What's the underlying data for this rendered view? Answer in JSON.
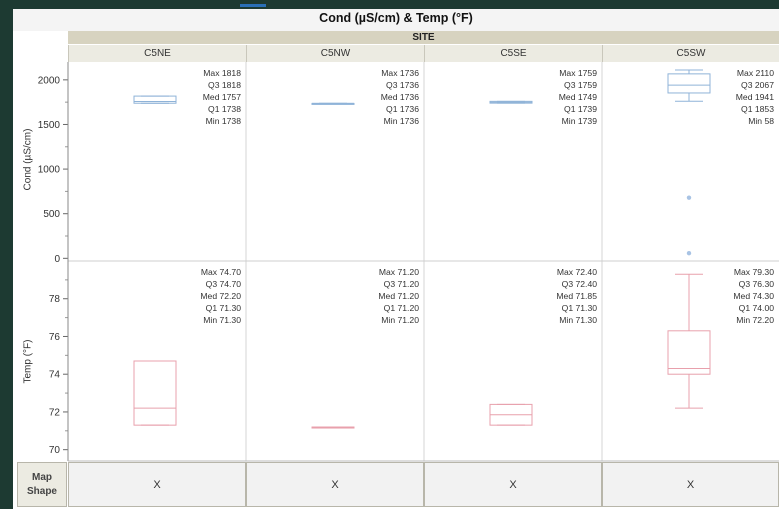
{
  "window_title": "Cond (µS/cm) & Temp (°F)",
  "group_label": "SITE",
  "map_shape_label": "Map\nShape",
  "map_shape_values": [
    "X",
    "X",
    "X",
    "X"
  ],
  "chart_data": {
    "type": "box",
    "title": "Cond (µS/cm) & Temp (°F)",
    "group_by": "SITE",
    "categories": [
      "C5NE",
      "C5NW",
      "C5SE",
      "C5SW"
    ],
    "panels": [
      {
        "ylabel": "Cond (µS/cm)",
        "ylim": [
          -30,
          2200
        ],
        "yticks": [
          0,
          500,
          1000,
          1500,
          2000
        ],
        "color": "#8fb3d8",
        "series": [
          {
            "site": "C5NE",
            "max": 1818,
            "q3": 1818,
            "med": 1757,
            "q1": 1738,
            "min": 1738,
            "outliers": [],
            "labels": [
              "Max 1818",
              "Q3 1818",
              "Med 1757",
              "Q1 1738",
              "Min 1738"
            ]
          },
          {
            "site": "C5NW",
            "max": 1736,
            "q3": 1736,
            "med": 1736,
            "q1": 1736,
            "min": 1736,
            "outliers": [],
            "labels": [
              "Max 1736",
              "Q3 1736",
              "Med 1736",
              "Q1 1736",
              "Min 1736"
            ]
          },
          {
            "site": "C5SE",
            "max": 1759,
            "q3": 1759,
            "med": 1749,
            "q1": 1739,
            "min": 1739,
            "outliers": [],
            "labels": [
              "Max 1759",
              "Q3 1759",
              "Med 1749",
              "Q1 1739",
              "Min 1739"
            ]
          },
          {
            "site": "C5SW",
            "max": 2110,
            "q3": 2067,
            "med": 1941,
            "q1": 1853,
            "min": 58,
            "whisker_low": 1760,
            "outliers": [
              680,
              58
            ],
            "labels": [
              "Max 2110",
              "Q3 2067",
              "Med 1941",
              "Q1 1853",
              "Min 58"
            ]
          }
        ]
      },
      {
        "ylabel": "Temp (°F)",
        "ylim": [
          69.4,
          80.0
        ],
        "yticks": [
          70,
          72,
          74,
          76,
          78
        ],
        "color": "#e8a0ac",
        "series": [
          {
            "site": "C5NE",
            "max": 74.7,
            "q3": 74.7,
            "med": 72.2,
            "q1": 71.3,
            "min": 71.3,
            "outliers": [],
            "labels": [
              "Max 74.70",
              "Q3 74.70",
              "Med 72.20",
              "Q1 71.30",
              "Min 71.30"
            ]
          },
          {
            "site": "C5NW",
            "max": 71.2,
            "q3": 71.2,
            "med": 71.2,
            "q1": 71.2,
            "min": 71.2,
            "outliers": [],
            "labels": [
              "Max 71.20",
              "Q3 71.20",
              "Med 71.20",
              "Q1 71.20",
              "Min 71.20"
            ]
          },
          {
            "site": "C5SE",
            "max": 72.4,
            "q3": 72.4,
            "med": 71.85,
            "q1": 71.3,
            "min": 71.3,
            "outliers": [],
            "labels": [
              "Max 72.40",
              "Q3 72.40",
              "Med 71.85",
              "Q1 71.30",
              "Min 71.30"
            ]
          },
          {
            "site": "C5SW",
            "max": 79.3,
            "q3": 76.3,
            "med": 74.3,
            "q1": 74.0,
            "min": 72.2,
            "outliers": [],
            "labels": [
              "Max 79.30",
              "Q3 76.30",
              "Med 74.30",
              "Q1 74.00",
              "Min 72.20"
            ]
          }
        ]
      }
    ]
  }
}
